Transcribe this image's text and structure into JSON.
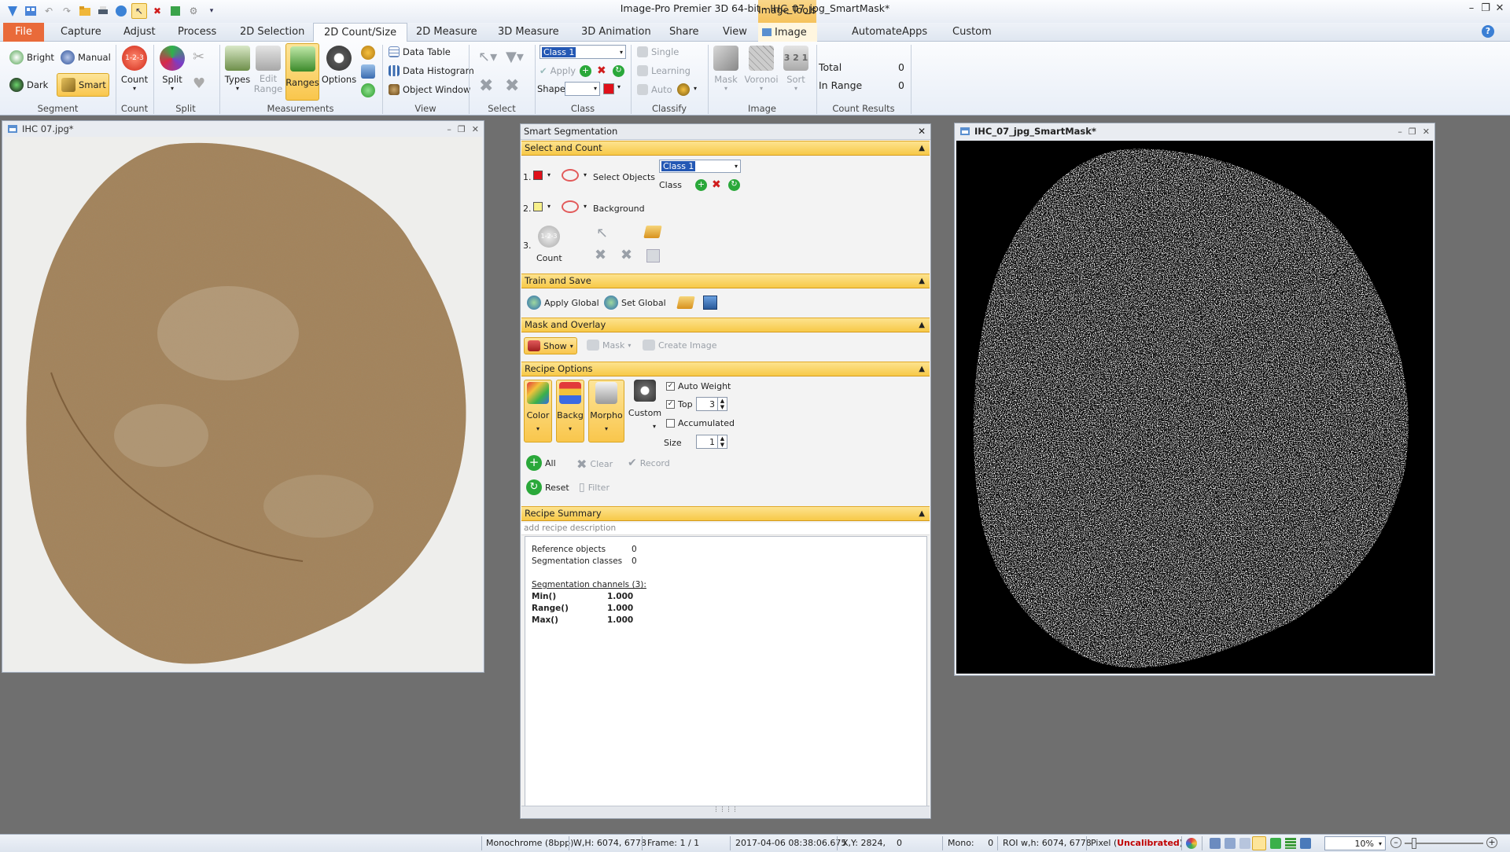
{
  "app": {
    "title": "Image-Pro Premier 3D 64-bit - IHC_07_jpg_SmartMask*",
    "context_tab": "Image Tools"
  },
  "tabs": [
    "File",
    "Capture",
    "Adjust",
    "Process",
    "2D Selection",
    "2D Count/Size",
    "2D Measure",
    "3D Measure",
    "3D Animation",
    "Share",
    "View",
    "Image",
    "Automate",
    "Apps",
    "Custom"
  ],
  "ribbon": {
    "segment": {
      "bright": "Bright",
      "manual": "Manual",
      "dark": "Dark",
      "smart": "Smart",
      "label": "Segment"
    },
    "count": {
      "count": "Count",
      "label": "Count"
    },
    "split": {
      "split": "Split",
      "label": "Split"
    },
    "measurements": {
      "types": "Types",
      "edit_range": "Edit\nRange",
      "ranges": "Ranges",
      "options": "Options",
      "label": "Measurements"
    },
    "view": {
      "data_table": "Data Table",
      "data_histogram": "Data Histogram",
      "object_window": "Object Window",
      "label": "View"
    },
    "select": {
      "label": "Select"
    },
    "class": {
      "class_value": "Class 1",
      "apply": "Apply",
      "shape": "Shape",
      "label": "Class"
    },
    "classify": {
      "single": "Single",
      "learning": "Learning",
      "auto": "Auto",
      "label": "Classify"
    },
    "image": {
      "mask": "Mask",
      "voronoi": "Voronoi",
      "sort": "Sort",
      "sort_icon": "3 2 1",
      "label": "Image"
    },
    "count_results": {
      "total_label": "Total",
      "total_value": "0",
      "in_range_label": "In Range",
      "in_range_value": "0",
      "label": "Count Results"
    }
  },
  "left_window": {
    "title": "IHC 07.jpg*"
  },
  "right_window": {
    "title": "IHC_07_jpg_SmartMask*"
  },
  "panel": {
    "title": "Smart Segmentation",
    "select_and_count": {
      "header": "Select and Count",
      "row1_num": "1.",
      "select_objects": "Select Objects",
      "class_value": "Class 1",
      "class_label": "Class",
      "row2_num": "2.",
      "background": "Background",
      "row3_num": "3.",
      "count_badge": "1-2-3",
      "count_label": "Count"
    },
    "train_and_save": {
      "header": "Train and Save",
      "apply_global": "Apply Global",
      "set_global": "Set Global"
    },
    "mask_and_overlay": {
      "header": "Mask and Overlay",
      "show": "Show",
      "mask": "Mask",
      "create_image": "Create Image"
    },
    "recipe_options": {
      "header": "Recipe Options",
      "color": "Color",
      "backg": "Backg",
      "morpho": "Morpho",
      "custom": "Custom",
      "auto_weight": "Auto Weight",
      "top": "Top",
      "top_value": "3",
      "accumulated": "Accumulated",
      "size": "Size",
      "size_value": "1",
      "all": "All",
      "clear": "Clear",
      "record": "Record",
      "reset": "Reset",
      "filter": "Filter"
    },
    "recipe_summary": {
      "header": "Recipe Summary",
      "placeholder": "add recipe description",
      "reference_objects_label": "Reference objects",
      "reference_objects_value": "0",
      "segmentation_classes_label": "Segmentation classes",
      "segmentation_classes_value": "0",
      "channels_title": "Segmentation channels (3):",
      "channels": [
        {
          "name": "Min()",
          "value": "1.000"
        },
        {
          "name": "Range()",
          "value": "1.000"
        },
        {
          "name": "Max()",
          "value": "1.000"
        }
      ]
    }
  },
  "status_bar": {
    "mode": "Monochrome (8bpp)",
    "wh": "W,H: 6074, 6778",
    "frame": "Frame: 1 / 1",
    "timestamp": "2017-04-06 08:38:06.675",
    "xy": "X,Y: 2824,    0",
    "mono": "Mono:     0",
    "roi": "ROI w,h: 6074, 6778",
    "pixel": "Pixel (",
    "uncalibrated": "Uncalibrated",
    "pixel_close": ")",
    "zoom": "10%"
  },
  "colors": {
    "accent_orange": "#f7c948",
    "file_tab": "#e96a3a",
    "uncalibrated": "#c00000"
  }
}
